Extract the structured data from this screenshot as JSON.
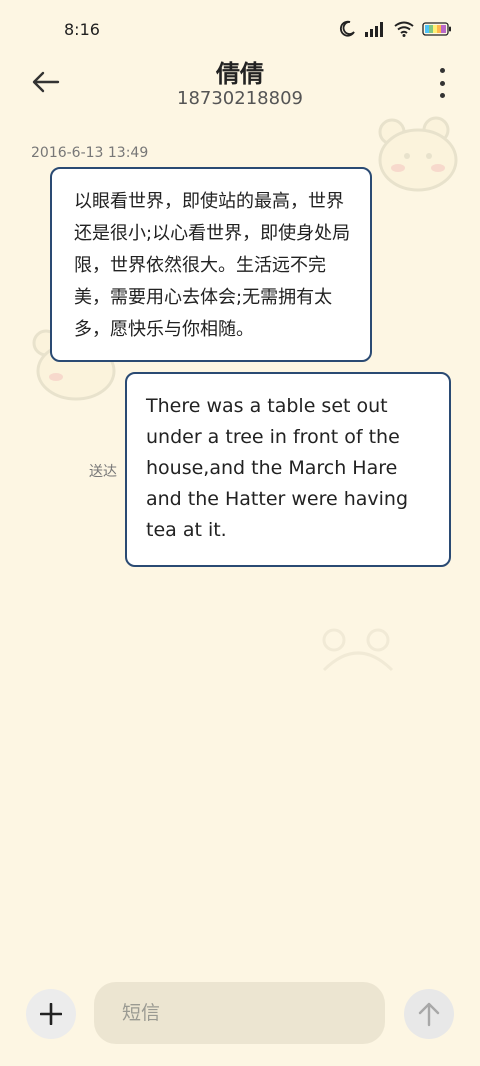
{
  "status_bar": {
    "time": "8:16",
    "icons": [
      "moon-icon",
      "signal-icon",
      "wifi-icon",
      "battery-icon"
    ]
  },
  "header": {
    "contact_name": "倩倩",
    "contact_number": "18730218809",
    "back_icon": "arrow-left-icon",
    "more_icon": "more-vertical-icon"
  },
  "conversation": {
    "timestamp": "2016-6-13 13:49",
    "messages": [
      {
        "direction": "received",
        "text": "以眼看世界，即使站的最高，世界还是很小;以心看世界，即使身处局限，世界依然很大。生活远不完美，需要用心去体会;无需拥有太多，愿快乐与你相随。"
      },
      {
        "direction": "sent",
        "text": "There was a table set out under a tree in front of the house,and the March Hare and the Hatter were having tea at it.",
        "status": "送达"
      }
    ]
  },
  "input_bar": {
    "add_icon": "plus-icon",
    "placeholder": "短信",
    "send_icon": "arrow-up-icon"
  },
  "colors": {
    "background": "#fdf6e3",
    "bubble_border": "#2a4a73",
    "bubble_fill": "#ffffff",
    "input_fill": "#ece5d1"
  }
}
